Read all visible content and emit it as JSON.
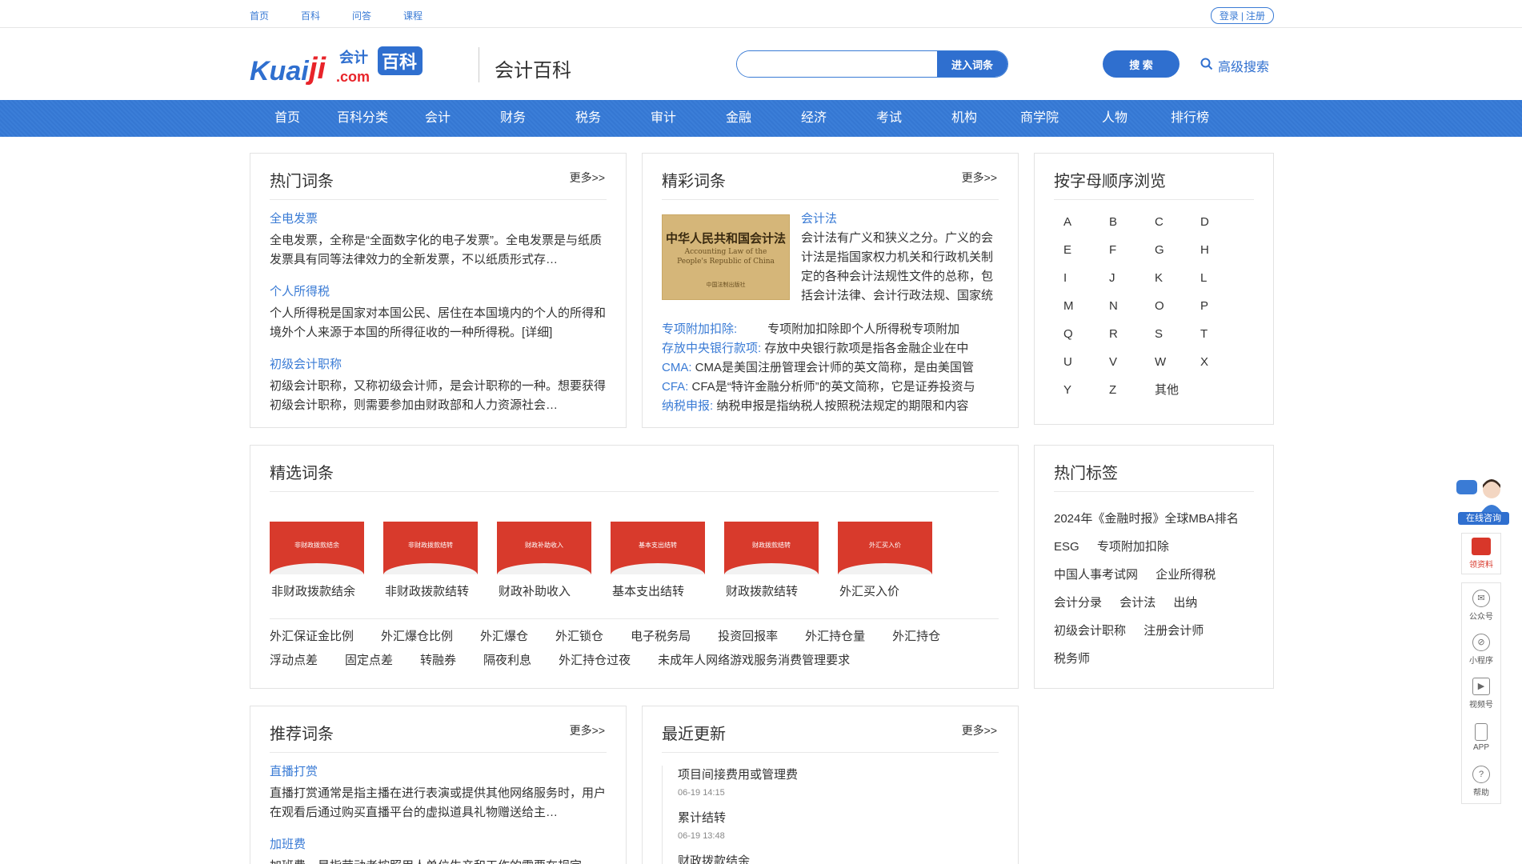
{
  "topbar": {
    "links": [
      "首页",
      "百科",
      "问答",
      "课程"
    ],
    "login": "登录",
    "sep": "|",
    "register": "注册"
  },
  "header": {
    "logo_text": "Kuaiji.com会计百科",
    "site_name": "会计百科",
    "search_placeholder": "",
    "enter_button": "进入词条",
    "search_button": "搜 索",
    "advanced_search": "高级搜索"
  },
  "nav": [
    "首页",
    "百科分类",
    "会计",
    "财务",
    "税务",
    "审计",
    "金融",
    "经济",
    "考试",
    "机构",
    "商学院",
    "人物",
    "排行榜"
  ],
  "hot_entries": {
    "title": "热门词条",
    "more": "更多>>",
    "items": [
      {
        "title": "全电发票",
        "desc": "全电发票，全称是“全面数字化的电子发票”。全电发票是与纸质发票具有同等法律效力的全新发票，不以纸质形式存…"
      },
      {
        "title": "个人所得税",
        "desc": "个人所得税是国家对本国公民、居住在本国境内的个人的所得和境外个人来源于本国的所得征收的一种所得税。[详细]"
      },
      {
        "title": "初级会计职称",
        "desc": "初级会计职称，又称初级会计师，是会计职称的一种。想要获得初级会计职称，则需要参加由财政部和人力资源社会…"
      }
    ]
  },
  "featured": {
    "title": "精彩词条",
    "more": "更多>>",
    "image": {
      "line1": "中华人民共和国会计法",
      "line2": "Accounting Law of the People's Republic of China",
      "line3": "中国法制出版社"
    },
    "main_title": "会计法",
    "main_desc": "会计法有广义和狭义之分。广义的会计法是指国家权力机关和行政机关制定的各种会计法规性文件的总称，包括会计法律、会计行政法规、国家统一的会计制度、地方性",
    "list": [
      {
        "k": "专项附加扣除:",
        "v": "专项附加扣除即个人所得税专项附加"
      },
      {
        "k": "存放中央银行款项:",
        "v": "存放中央银行款项是指各金融企业在中"
      },
      {
        "k": "CMA:",
        "v": "CMA是美国注册管理会计师的英文简称，是由美国管"
      },
      {
        "k": "CFA:",
        "v": "CFA是“特许金融分析师”的英文简称，它是证券投资与"
      },
      {
        "k": "纳税申报:",
        "v": "纳税申报是指纳税人按照税法规定的期限和内容"
      }
    ]
  },
  "alphabet": {
    "title": "按字母顺序浏览",
    "letters": [
      "A",
      "B",
      "C",
      "D",
      "E",
      "F",
      "G",
      "H",
      "I",
      "J",
      "K",
      "L",
      "M",
      "N",
      "O",
      "P",
      "Q",
      "R",
      "S",
      "T",
      "U",
      "V",
      "W",
      "X",
      "Y",
      "Z",
      "其他"
    ]
  },
  "selected": {
    "title": "精选词条",
    "cards": [
      {
        "caption": "非财政拨款结余",
        "img_label": "非财政拨款结余"
      },
      {
        "caption": "非财政拨款结转",
        "img_label": "非财政拨款结转"
      },
      {
        "caption": "财政补助收入",
        "img_label": "财政补助收入"
      },
      {
        "caption": "基本支出结转",
        "img_label": "基本支出结转"
      },
      {
        "caption": "财政拨款结转",
        "img_label": "财政拨款结转"
      },
      {
        "caption": "外汇买入价",
        "img_label": "外汇买入价"
      }
    ],
    "tags_row1": [
      "外汇保证金比例",
      "外汇爆仓比例",
      "外汇爆仓",
      "外汇锁仓",
      "电子税务局",
      "投资回报率",
      "外汇持仓量",
      "外汇持仓"
    ],
    "tags_row2": [
      "浮动点差",
      "固定点差",
      "转融券",
      "隔夜利息",
      "外汇持仓过夜",
      "未成年人网络游戏服务消费管理要求"
    ]
  },
  "hot_tags": {
    "title": "热门标签",
    "tags": [
      "2024年《金融时报》全球MBA排名",
      "ESG",
      "专项附加扣除",
      "中国人事考试网",
      "企业所得税",
      "会计分录",
      "会计法",
      "出纳",
      "初级会计职称",
      "注册会计师",
      "税务师"
    ]
  },
  "recommended": {
    "title": "推荐词条",
    "more": "更多>>",
    "items": [
      {
        "title": "直播打赏",
        "desc": "直播打赏通常是指主播在进行表演或提供其他网络服务时，用户在观看后通过购买直播平台的虚拟道具礼物赠送给主…"
      },
      {
        "title": "加班费",
        "desc": "加班费，是指劳动者按照用人单位生产和工作的需要在规定"
      }
    ]
  },
  "recent": {
    "title": "最近更新",
    "more": "更多>>",
    "items": [
      {
        "title": "项目间接费用或管理费",
        "date": "06-19 14:15"
      },
      {
        "title": "累计结转",
        "date": "06-19 13:48"
      },
      {
        "title": "财政拨款结余",
        "date": ""
      }
    ]
  },
  "floatbar": {
    "consult": "在线咨询",
    "items": [
      {
        "label": "领资料",
        "icon": "gift-icon"
      },
      {
        "label": "公众号",
        "icon": "wechat-icon"
      },
      {
        "label": "小程序",
        "icon": "miniprogram-icon"
      },
      {
        "label": "视频号",
        "icon": "video-icon"
      },
      {
        "label": "APP",
        "icon": "phone-icon"
      },
      {
        "label": "帮助",
        "icon": "help-icon"
      }
    ]
  },
  "colors": {
    "brand_blue": "#2f6fcf",
    "link_blue": "#3a7bd5",
    "card_red": "#d83a2c"
  }
}
